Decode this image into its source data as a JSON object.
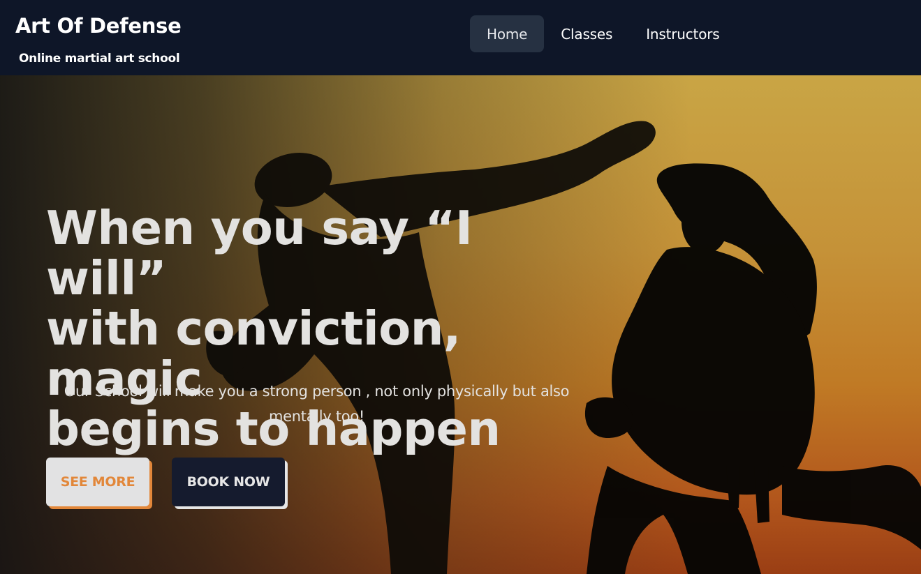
{
  "header": {
    "title": "Art Of Defense",
    "tagline": "Online martial art school",
    "nav": [
      {
        "label": "Home",
        "active": true
      },
      {
        "label": "Classes",
        "active": false
      },
      {
        "label": "Instructors",
        "active": false
      }
    ]
  },
  "hero": {
    "heading_lines": [
      "When you say “I will”",
      "with conviction, magic",
      "begins to happen"
    ],
    "subtitle_lines": [
      "Our School will make you a strong person , not only physically but also",
      "mentally too!"
    ],
    "buttons": {
      "see_more": "SEE MORE",
      "book_now": "BOOK NOW"
    },
    "colors": {
      "accent": "#e2873a",
      "navy": "#0e1628",
      "sky_top": "#c9a545",
      "sky_bottom": "#9a3e14"
    }
  }
}
